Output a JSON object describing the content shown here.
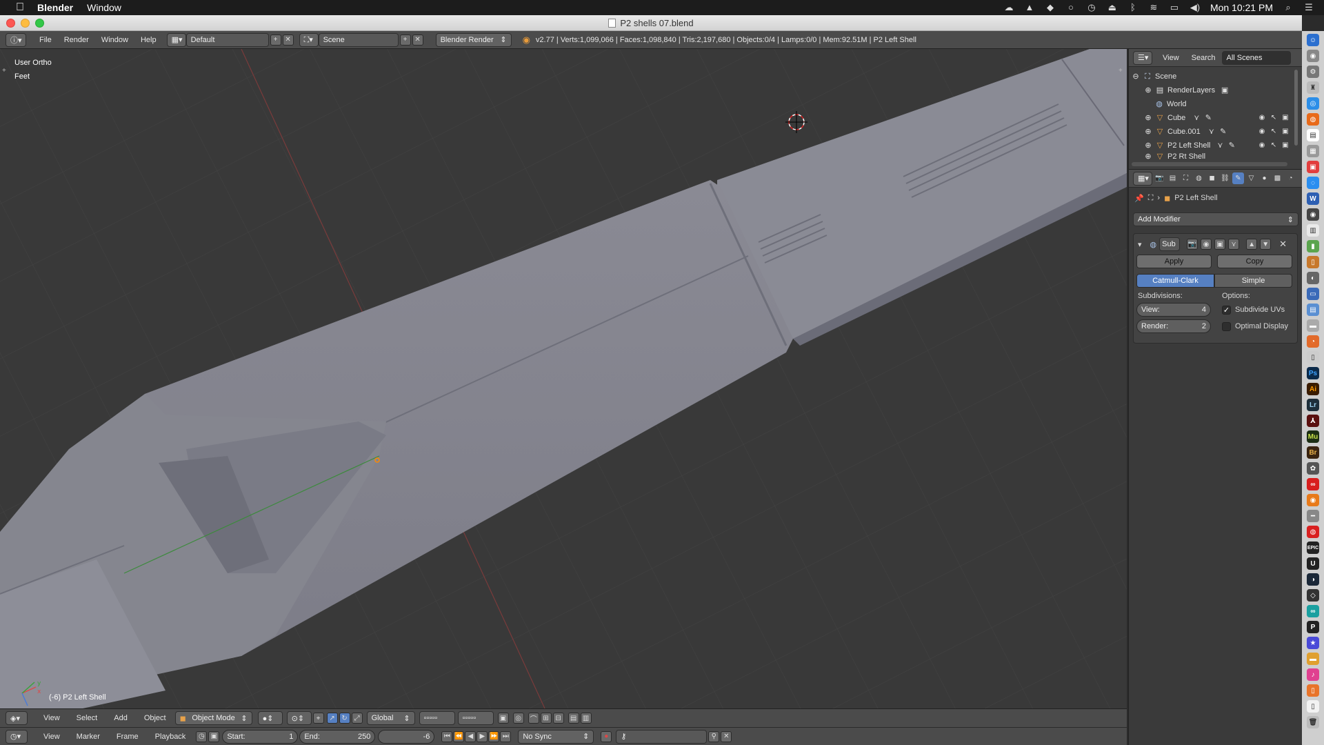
{
  "menubar": {
    "app": "Blender",
    "items": [
      "Window"
    ],
    "clock": "Mon 10:21 PM"
  },
  "window": {
    "title": "P2 shells 07.blend"
  },
  "info_header": {
    "menus": [
      "File",
      "Render",
      "Window",
      "Help"
    ],
    "screen_layout": "Default",
    "scene": "Scene",
    "render_engine": "Blender Render",
    "stats": "v2.77 | Verts:1,099,066 | Faces:1,098,840 | Tris:2,197,680 | Objects:0/4 | Lamps:0/0 | Mem:92.51M | P2 Left Shell"
  },
  "viewport": {
    "view_name": "User Ortho",
    "units": "Feet",
    "object_info": "(-6) P2 Left Shell",
    "axis_x": "x",
    "axis_y": "y"
  },
  "view3d_header": {
    "menus": [
      "View",
      "Select",
      "Add",
      "Object"
    ],
    "mode": "Object Mode",
    "orientation": "Global"
  },
  "timeline": {
    "menus": [
      "View",
      "Marker",
      "Frame",
      "Playback"
    ],
    "start_label": "Start:",
    "start_value": "1",
    "end_label": "End:",
    "end_value": "250",
    "current_frame": "-6",
    "sync": "No Sync"
  },
  "outliner": {
    "menus": [
      "View",
      "Search"
    ],
    "filter": "All Scenes",
    "items": [
      {
        "label": "Scene"
      },
      {
        "label": "RenderLayers"
      },
      {
        "label": "World"
      },
      {
        "label": "Cube"
      },
      {
        "label": "Cube.001"
      },
      {
        "label": "P2 Left Shell"
      },
      {
        "label": "P2 Rt Shell"
      }
    ]
  },
  "properties": {
    "context_object": "P2 Left Shell",
    "add_modifier": "Add Modifier",
    "modifier": {
      "name": "Sub",
      "apply": "Apply",
      "copy": "Copy",
      "type_catmull": "Catmull-Clark",
      "type_simple": "Simple",
      "subdivisions_label": "Subdivisions:",
      "options_label": "Options:",
      "view_label": "View:",
      "view_value": "4",
      "render_label": "Render:",
      "render_value": "2",
      "subdivide_uvs": "Subdivide UVs",
      "optimal_display": "Optimal Display"
    }
  },
  "dock": {
    "labels": [
      "Ps",
      "Ai",
      "Lr",
      "Mu",
      "Br",
      "EPIC",
      "U",
      "P"
    ]
  }
}
